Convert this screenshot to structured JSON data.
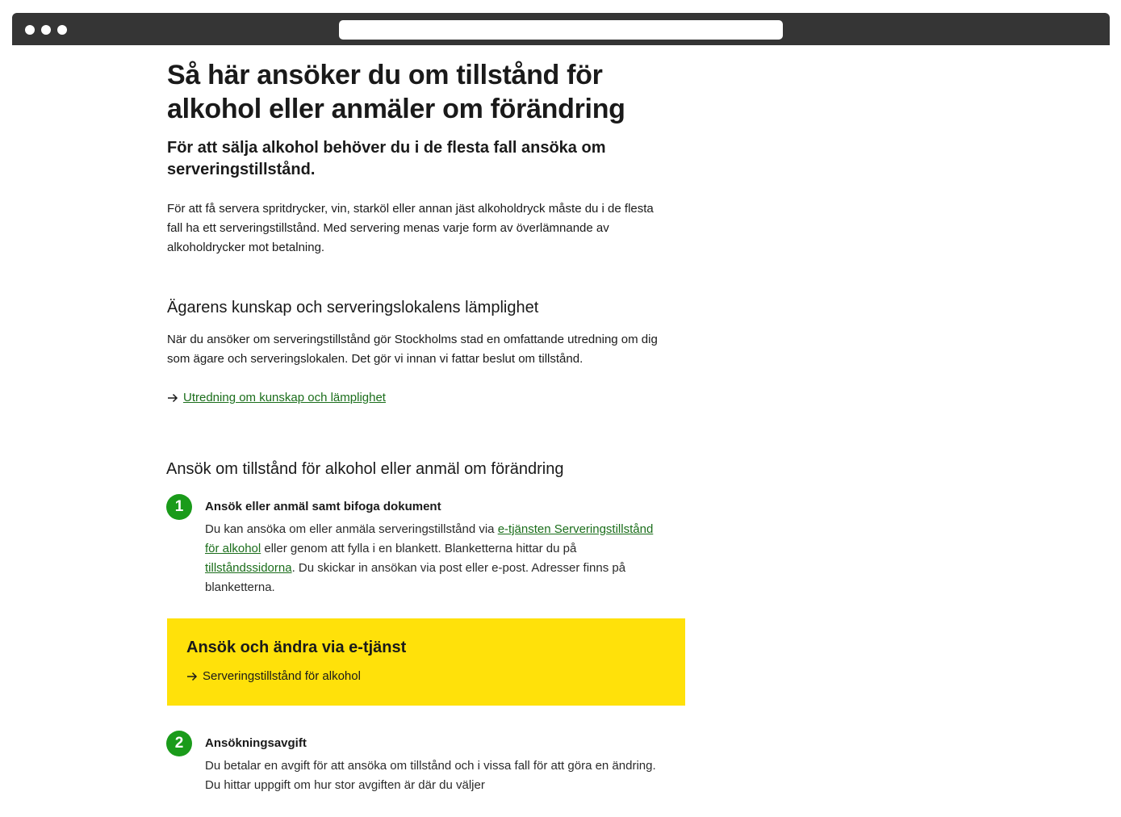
{
  "browser": {
    "address": ""
  },
  "page": {
    "title": "Så här ansöker du om tillstånd för alkohol eller anmäler om förändring",
    "lead": "För att sälja alkohol behöver du i de flesta fall ansöka om serveringstillstånd.",
    "intro": "För att få servera spritdrycker, vin, starköl eller annan jäst alkoholdryck måste du i de flesta fall ha ett serveringstillstånd. Med servering menas varje form av överlämnande av alkoholdrycker mot betalning."
  },
  "knowledge": {
    "heading": "Ägarens kunskap och serveringslokalens lämplighet",
    "text": "När du ansöker om serveringstillstånd gör Stockholms stad en omfattande utredning om dig som ägare och serveringslokalen. Det gör vi innan vi fattar beslut om tillstånd.",
    "link_label": "Utredning om kunskap och lämplighet",
    "link_icon": "arrow-right-icon"
  },
  "apply": {
    "heading": "Ansök om tillstånd för alkohol eller anmäl om förändring",
    "steps": [
      {
        "number": "1",
        "title": "Ansök eller anmäl samt bifoga dokument",
        "body_part1": "Du kan ansöka om eller anmäla serveringstillstånd via ",
        "link1": "e-tjänsten Serveringstillstånd för alkohol",
        "body_part2": " eller genom att fylla i en blankett. Blanketterna hittar du på ",
        "link2": "tillståndssidorna",
        "body_part3": ". Du skickar in ansökan via post eller e-post. Adresser finns på blanketterna."
      },
      {
        "number": "2",
        "title": "Ansökningsavgift",
        "body": "Du betalar en avgift för att ansöka om tillstånd och i vissa fall för att göra en ändring. Du hittar uppgift om hur stor avgiften är där du väljer"
      }
    ]
  },
  "eservice": {
    "title": "Ansök och ändra via e-tjänst",
    "link_label": "Serveringstillstånd för alkohol",
    "link_icon": "arrow-right-icon",
    "background": "#ffe10a"
  },
  "colors": {
    "link": "#1b6e1b",
    "badge": "#1a9b1a",
    "browser_bar": "#353535"
  }
}
